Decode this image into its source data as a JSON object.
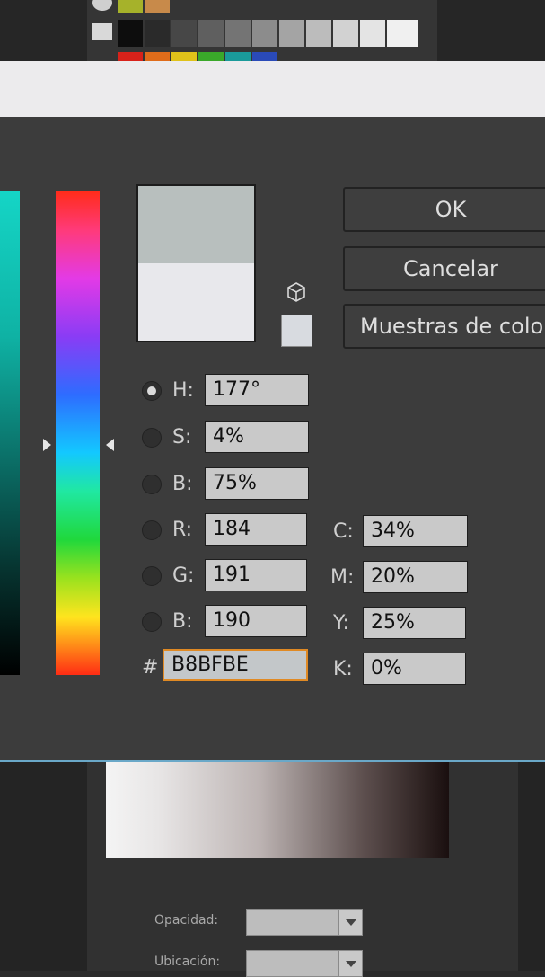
{
  "dialog": {
    "buttons": {
      "ok": "OK",
      "cancel": "Cancelar",
      "swatches": "Muestras de colo"
    },
    "hsb": [
      {
        "label": "H:",
        "value": "177°",
        "selected": true
      },
      {
        "label": "S:",
        "value": "4%",
        "selected": false
      },
      {
        "label": "B:",
        "value": "75%",
        "selected": false
      }
    ],
    "rgb": [
      {
        "label": "R:",
        "value": "184",
        "selected": false
      },
      {
        "label": "G:",
        "value": "191",
        "selected": false
      },
      {
        "label": "B:",
        "value": "190",
        "selected": false
      }
    ],
    "hex": {
      "label": "#",
      "value": "B8BFBE"
    },
    "cmyk": [
      {
        "label": "C:",
        "value": "34%"
      },
      {
        "label": "M:",
        "value": "20%"
      },
      {
        "label": "Y:",
        "value": "25%"
      },
      {
        "label": "K:",
        "value": "0%"
      }
    ],
    "colors": {
      "new_color": "#b8bfbe",
      "current_color": "#e8e8ec",
      "focus_accent": "#e08a24"
    }
  },
  "background_panel": {
    "opacity_label": "Opacidad:",
    "location_label": "Ubicación:"
  }
}
